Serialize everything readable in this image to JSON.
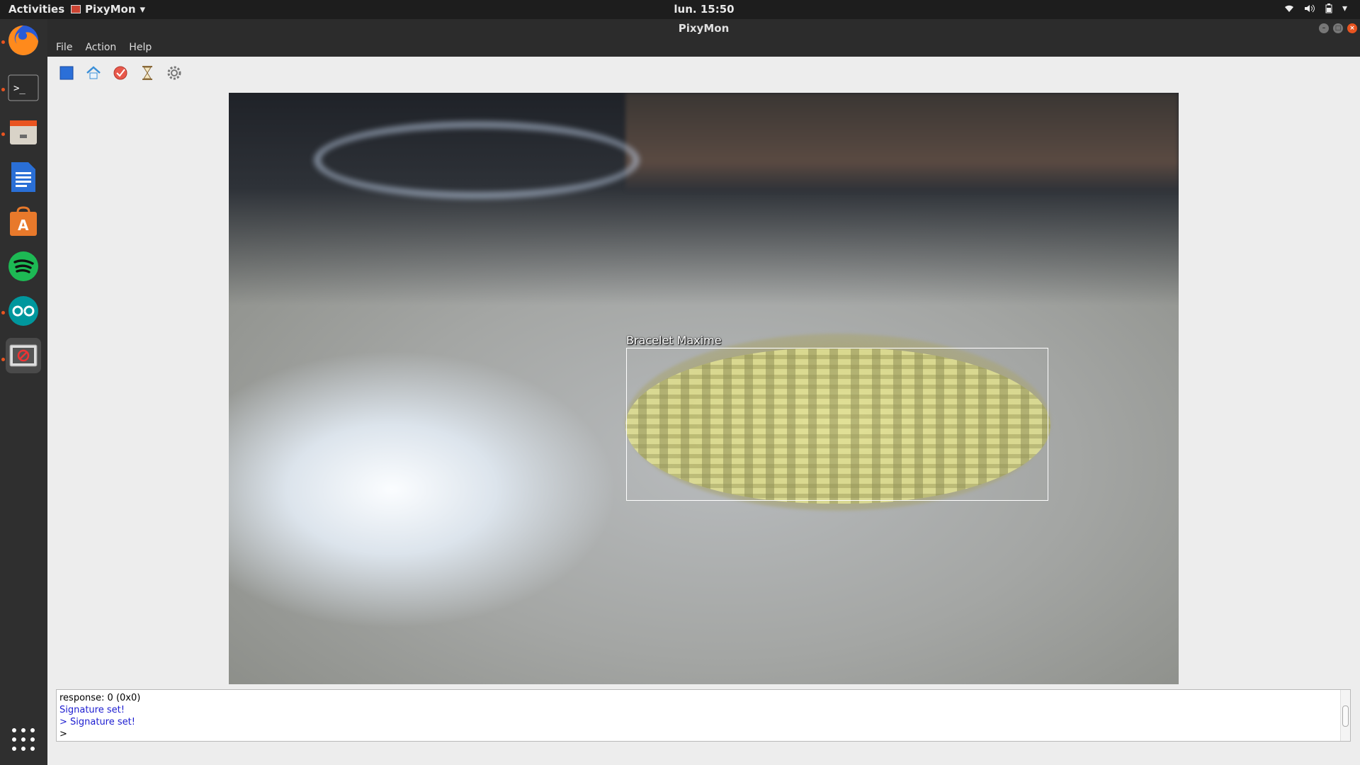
{
  "topbar": {
    "activities": "Activities",
    "app_name": "PixyMon",
    "clock": "lun. 15:50"
  },
  "window": {
    "title": "PixyMon"
  },
  "menu": {
    "file": "File",
    "action": "Action",
    "help": "Help"
  },
  "toolbar": {
    "icons": [
      "stop-icon",
      "home-icon",
      "signature-icon",
      "hourglass-icon",
      "gear-icon"
    ]
  },
  "video": {
    "label": "Bracelet Maxime"
  },
  "console": {
    "line1": "response: 0 (0x0)",
    "line2": "Signature set!",
    "line3": "> Signature set!",
    "line4": ">"
  },
  "dock": {
    "apps": [
      "firefox",
      "terminal",
      "files",
      "libreoffice-writer",
      "ubuntu-software",
      "spotify",
      "arduino",
      "pixymon"
    ]
  },
  "colors": {
    "accent": "#e95420",
    "console_blue": "#1c1cd0"
  }
}
